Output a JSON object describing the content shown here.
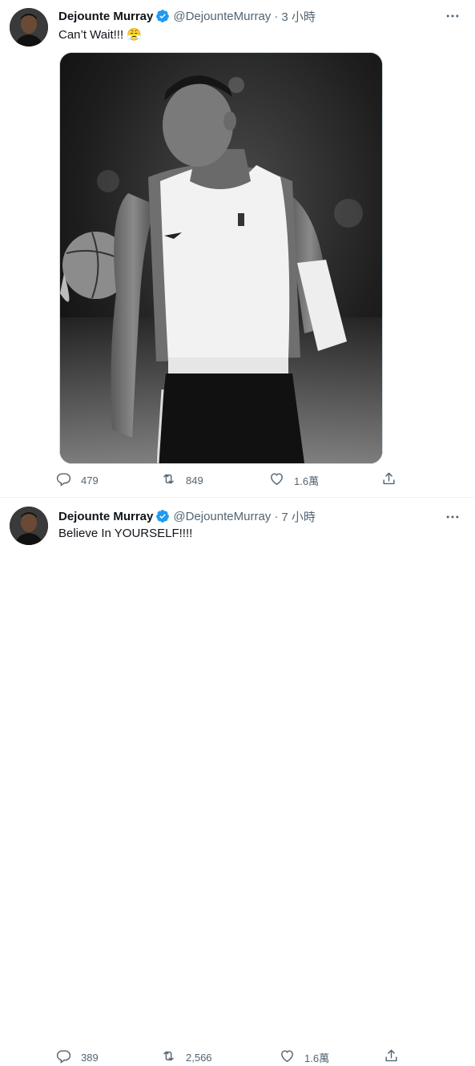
{
  "tweets": [
    {
      "author_name": "Dejounte Murray",
      "handle": "@DejounteMurray",
      "separator": "·",
      "time": "3 小時",
      "text": "Can’t Wait!!! 😤",
      "counts": {
        "replies": "479",
        "retweets": "849",
        "likes": "1.6萬"
      }
    },
    {
      "author_name": "Dejounte Murray",
      "handle": "@DejounteMurray",
      "separator": "·",
      "time": "7 小時",
      "text": "Believe In YOURSELF!!!!",
      "counts": {
        "replies": "389",
        "retweets": "2,566",
        "likes": "1.6萬"
      }
    }
  ],
  "icons": {
    "verified": "verified-badge-icon",
    "more": "more-icon",
    "reply": "reply-icon",
    "retweet": "retweet-icon",
    "like": "like-icon",
    "share": "share-icon"
  },
  "colors": {
    "text": "#0f1419",
    "secondary": "#536471",
    "verified": "#1d9bf0",
    "divider": "#eff3f4"
  }
}
